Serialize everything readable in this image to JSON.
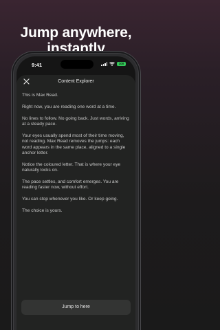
{
  "headline": {
    "line1": "Jump anywhere,",
    "line2": "instantly"
  },
  "status_bar": {
    "time": "9:41",
    "battery": "100"
  },
  "sheet": {
    "title": "Content Explorer",
    "close_icon": "close-icon",
    "paragraphs": [
      "This is Max Read.",
      "Right now, you are reading one word at a time.",
      "No lines to follow. No going back. Just words, arriving at a steady pace.",
      "Your eyes usually spend most of their time moving, not reading. Max Read removes the jumps: each word appears in the same place, aligned to a single anchor letter.",
      "Notice the coloured letter. That is where your eye naturally locks on.",
      "The pace settles, and comfort emerges. You are reading faster now, without effort.",
      "You can stop whenever you like. Or keep going.",
      "The choice is yours."
    ],
    "jump_button_label": "Jump to here"
  },
  "colors": {
    "battery": "#34c759",
    "sheet_background": "#222322",
    "button_background": "#333433"
  }
}
